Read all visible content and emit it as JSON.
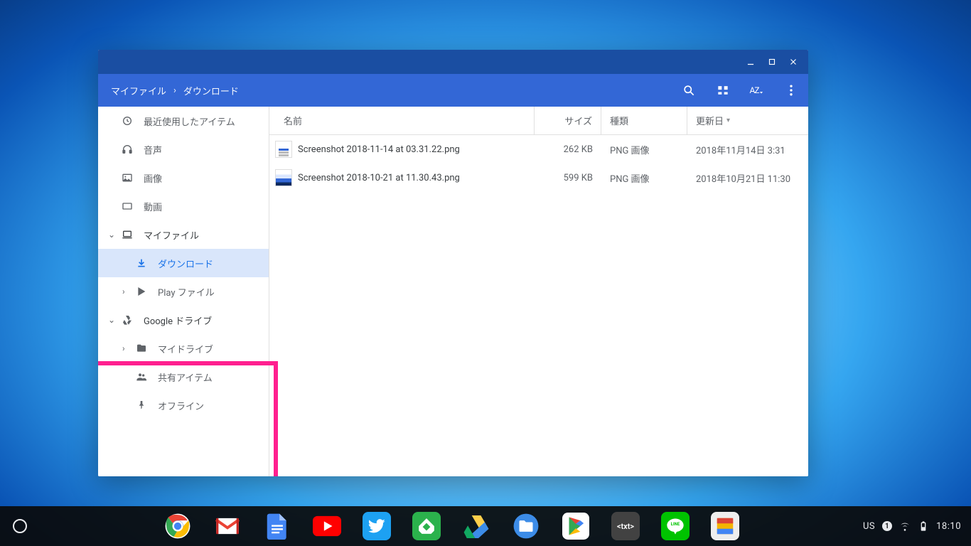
{
  "breadcrumb": {
    "root": "マイファイル",
    "current": "ダウンロード"
  },
  "toolbar": {
    "sort_label": "AZ"
  },
  "columns": {
    "name": "名前",
    "size": "サイズ",
    "type": "種類",
    "date": "更新日"
  },
  "sidebar": {
    "recent": "最近使用したアイテム",
    "audio": "音声",
    "images": "画像",
    "videos": "動画",
    "myfiles": "マイファイル",
    "downloads": "ダウンロード",
    "playfiles": "Play ファイル",
    "gdrive": "Google ドライブ",
    "mydrive": "マイドライブ",
    "shared": "共有アイテム",
    "offline": "オフライン"
  },
  "files": [
    {
      "name": "Screenshot 2018-11-14 at 03.31.22.png",
      "size": "262 KB",
      "type": "PNG 画像",
      "date": "2018年11月14日 3:31"
    },
    {
      "name": "Screenshot 2018-10-21 at 11.30.43.png",
      "size": "599 KB",
      "type": "PNG 画像",
      "date": "2018年10月21日 11:30"
    }
  ],
  "tray": {
    "kbd": "US",
    "notif": "1",
    "time": "18:10"
  }
}
